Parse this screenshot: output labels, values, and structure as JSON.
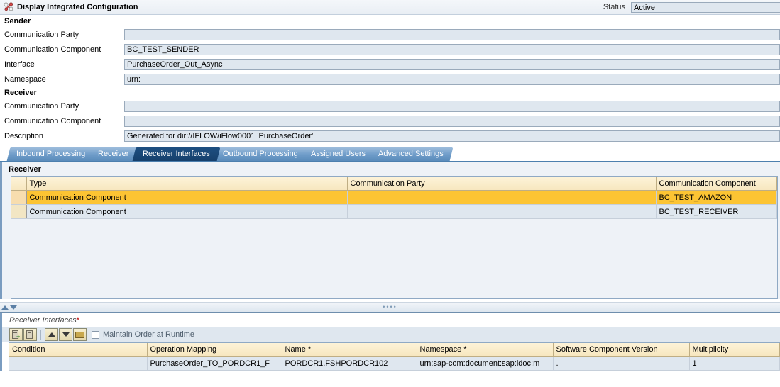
{
  "window": {
    "title": "Display Integrated Configuration",
    "title_icon": "molecule-icon",
    "status_label": "Status",
    "status_value": "Active"
  },
  "sender": {
    "group_title": "Sender",
    "fields": [
      {
        "label": "Communication Party",
        "value": ""
      },
      {
        "label": "Communication Component",
        "value": "BC_TEST_SENDER"
      },
      {
        "label": "Interface",
        "value": "PurchaseOrder_Out_Async"
      },
      {
        "label": "Namespace",
        "value": "urn:"
      }
    ]
  },
  "receiver": {
    "group_title": "Receiver",
    "fields": [
      {
        "label": "Communication Party",
        "value": ""
      },
      {
        "label": "Communication Component",
        "value": ""
      },
      {
        "label": "Description",
        "value": "Generated for dir://IFLOW/iFlow0001 'PurchaseOrder'"
      }
    ]
  },
  "tabs": [
    {
      "label": "Inbound Processing",
      "active": false
    },
    {
      "label": "Receiver",
      "active": false
    },
    {
      "label": "Receiver Interfaces",
      "active": true
    },
    {
      "label": "Outbound Processing",
      "active": false
    },
    {
      "label": "Assigned Users",
      "active": false
    },
    {
      "label": "Advanced Settings",
      "active": false
    }
  ],
  "receiver_panel": {
    "subtitle": "Receiver",
    "columns": [
      "Type",
      "Communication Party",
      "Communication Component"
    ],
    "rows": [
      {
        "selected": true,
        "type": "Communication Component",
        "party": "",
        "component": "BC_TEST_AMAZON"
      },
      {
        "selected": false,
        "type": "Communication Component",
        "party": "",
        "component": "BC_TEST_RECEIVER"
      }
    ]
  },
  "splitter": {
    "collapse_up_icon": "triangle-up-icon",
    "collapse_down_icon": "triangle-down-icon",
    "grip": "••••"
  },
  "receiver_interfaces": {
    "title": "Receiver Interfaces",
    "required_marker": "*",
    "toolbar": {
      "insert_row_icon": "insert-row-icon",
      "delete_row_icon": "delete-row-icon",
      "move_up_icon": "move-up-icon",
      "move_down_icon": "move-down-icon",
      "open_icon": "open-folder-icon",
      "checkbox_label": "Maintain Order at Runtime",
      "checkbox_checked": false
    },
    "columns": [
      "Condition",
      "Operation Mapping",
      "Name *",
      "Namespace *",
      "Software Component Version",
      "Multiplicity"
    ],
    "rows": [
      {
        "condition": "",
        "operation_mapping": "PurchaseOrder_TO_PORDCR1_F",
        "name": "PORDCR1.FSHPORDCR102",
        "namespace": "urn:sap-com:document:sap:idoc:m",
        "software_component_version": ".",
        "multiplicity": "1"
      }
    ]
  },
  "colors": {
    "accent_blue": "#4c7fae",
    "field_bg": "#dfe7ef",
    "header_yellow": "#f7e7bf",
    "selected_row": "#fcc433",
    "panel_bg": "#eef2f7"
  }
}
